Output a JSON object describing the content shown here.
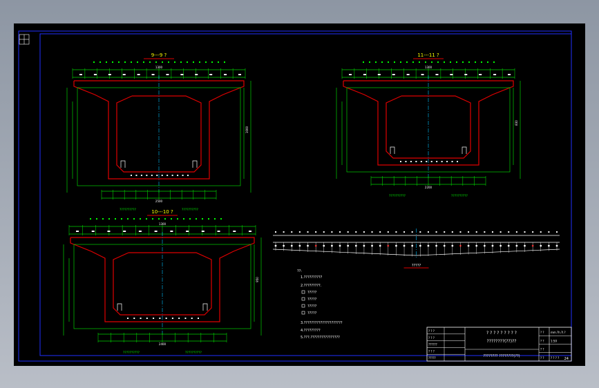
{
  "drawing": {
    "colors": {
      "background": "#000000",
      "frame": "#1f2fff",
      "concrete": "#e00000",
      "dimension": "#00d000",
      "axis": "#00c0ff",
      "text_white": "#ffffff",
      "text_yellow": "#ffff00",
      "text_green": "#00ff00"
    },
    "sections": [
      {
        "id": "s9",
        "title": "9---9 ?",
        "dim_top": "1300",
        "dim_height": "1000",
        "dim_total": "2500",
        "caption_left": "??????????",
        "caption_right": "??????????"
      },
      {
        "id": "s11",
        "title": "11---11 ?",
        "dim_top": "1300",
        "dim_height": "830",
        "dim_total": "2200",
        "caption_left": "??????????",
        "caption_right": "??????????"
      },
      {
        "id": "s10",
        "title": "10---10 ?",
        "dim_top": "1300",
        "dim_height": "950",
        "dim_total": "2400",
        "caption_left": "??????????",
        "caption_right": "??????????"
      }
    ],
    "elevation": {
      "title": "?????"
    },
    "notes": {
      "heading": "??:",
      "items": [
        "1.??????????",
        "2.?????????.",
        "?????",
        "?????",
        "?????",
        "?????",
        "3.?????????????????????",
        "4.?????????",
        "5.???.????????????????"
      ]
    },
    "title_block": {
      "left_rows": [
        "? ? ?",
        "? ? ?",
        "??????",
        "? ? ?",
        "?????"
      ],
      "main_title_1": "? ? ? ? ? ? ? ? ?",
      "main_title_2": "????????(??)??",
      "main_title_3": "???????? ????????(??)",
      "right_rows": [
        "? ?",
        "? ?",
        "? ?",
        "? ?"
      ],
      "right_vals": [
        "mm.?h.?l.?",
        "1:50",
        "",
        "? ? ? ?"
      ],
      "page_code": "24"
    }
  }
}
